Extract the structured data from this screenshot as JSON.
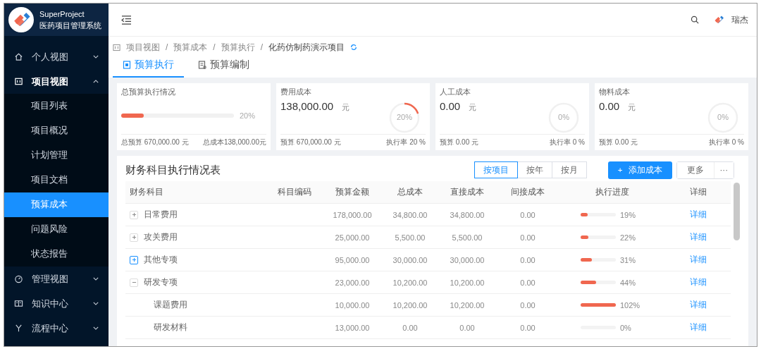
{
  "app": {
    "name": "SuperProject",
    "subtitle": "医药项目管理系统"
  },
  "sidebar": {
    "items": [
      {
        "label": "个人视图",
        "expanded": false
      },
      {
        "label": "项目视图",
        "expanded": true,
        "children": [
          {
            "label": "项目列表",
            "selected": false
          },
          {
            "label": "项目概况",
            "selected": false
          },
          {
            "label": "计划管理",
            "selected": false
          },
          {
            "label": "项目文档",
            "selected": false
          },
          {
            "label": "预算成本",
            "selected": true
          },
          {
            "label": "问题风险",
            "selected": false
          },
          {
            "label": "状态报告",
            "selected": false
          }
        ]
      },
      {
        "label": "管理视图",
        "expanded": false
      },
      {
        "label": "知识中心",
        "expanded": false
      },
      {
        "label": "流程中心",
        "expanded": false
      }
    ]
  },
  "header": {
    "user": "瑞杰"
  },
  "breadcrumb": [
    {
      "label": "项目视图"
    },
    {
      "separator": "/",
      "label": "预算成本"
    },
    {
      "separator": "/",
      "label": "预算执行"
    },
    {
      "separator": "/",
      "label": "化药仿制药演示项目"
    }
  ],
  "tabs": [
    {
      "label": "预算执行",
      "selected": true
    },
    {
      "label": "预算编制",
      "selected": false
    }
  ],
  "cards": [
    {
      "kind": "bar",
      "title": "总预算执行情况",
      "level": 0.2,
      "percent": "20%",
      "footer_left": "总预算 670,000.00 元",
      "footer_right": "总成本138,000.00元"
    },
    {
      "kind": "ring",
      "title": "费用成本",
      "amount": "138,000.00",
      "unit": "元",
      "level": 0.2,
      "percent": "20%",
      "footer_left": "预算 670,000.00 元",
      "footer_right": "执行率 20 %"
    },
    {
      "kind": "ring",
      "title": "人工成本",
      "amount": "0.00",
      "unit": "元",
      "level": 0,
      "percent": "0%",
      "footer_left": "预算 0.00 元",
      "footer_right": "执行率 0 %"
    },
    {
      "kind": "ring",
      "title": "物料成本",
      "amount": "0.00",
      "unit": "元",
      "level": 0,
      "percent": "0%",
      "footer_left": "预算 0.00 元",
      "footer_right": "执行率 0 %"
    }
  ],
  "table": {
    "title": "财务科目执行情况表",
    "views": [
      {
        "label": "按项目",
        "selected": true
      },
      {
        "label": "按年",
        "selected": false
      },
      {
        "label": "按月",
        "selected": false
      }
    ],
    "add_icon": "+",
    "add_button": "添加成本",
    "more_button": "更多",
    "more_icon": "···",
    "columns": [
      "财务科目",
      "科目编码",
      "预算金额",
      "总成本",
      "直接成本",
      "间接成本",
      "执行进度",
      "详细"
    ],
    "rows": [
      {
        "name": "日常费用",
        "expanded": false,
        "highlighted": false,
        "budget": "178,000.00",
        "total": "34,800.00",
        "direct": "34,800.00",
        "indirect": "0.00",
        "level": 0.19,
        "percent": "19%",
        "detail": "详细"
      },
      {
        "name": "攻关费用",
        "expanded": false,
        "highlighted": false,
        "budget": "25,000.00",
        "total": "5,500.00",
        "direct": "5,500.00",
        "indirect": "0.00",
        "level": 0.22,
        "percent": "22%",
        "detail": "详细"
      },
      {
        "name": "其他专项",
        "expanded": false,
        "highlighted": true,
        "budget": "95,000.00",
        "total": "30,000.00",
        "direct": "30,000.00",
        "indirect": "0.00",
        "level": 0.31,
        "percent": "31%",
        "detail": "详细"
      },
      {
        "name": "研发专项",
        "expanded": true,
        "highlighted": false,
        "budget": "23,000.00",
        "total": "10,200.00",
        "direct": "10,200.00",
        "indirect": "0.00",
        "level": 0.44,
        "percent": "44%",
        "detail": "详细",
        "children": [
          {
            "name": "课题费用",
            "budget": "10,000.00",
            "total": "10,200.00",
            "direct": "10,200.00",
            "indirect": "0.00",
            "level": 1,
            "percent": "102%",
            "detail": "详细"
          },
          {
            "name": "研发材料",
            "budget": "13,000.00",
            "total": "0.00",
            "direct": "0.00",
            "indirect": "0.00",
            "level": 0,
            "percent": "0%",
            "detail": "详细"
          }
        ]
      }
    ]
  }
}
